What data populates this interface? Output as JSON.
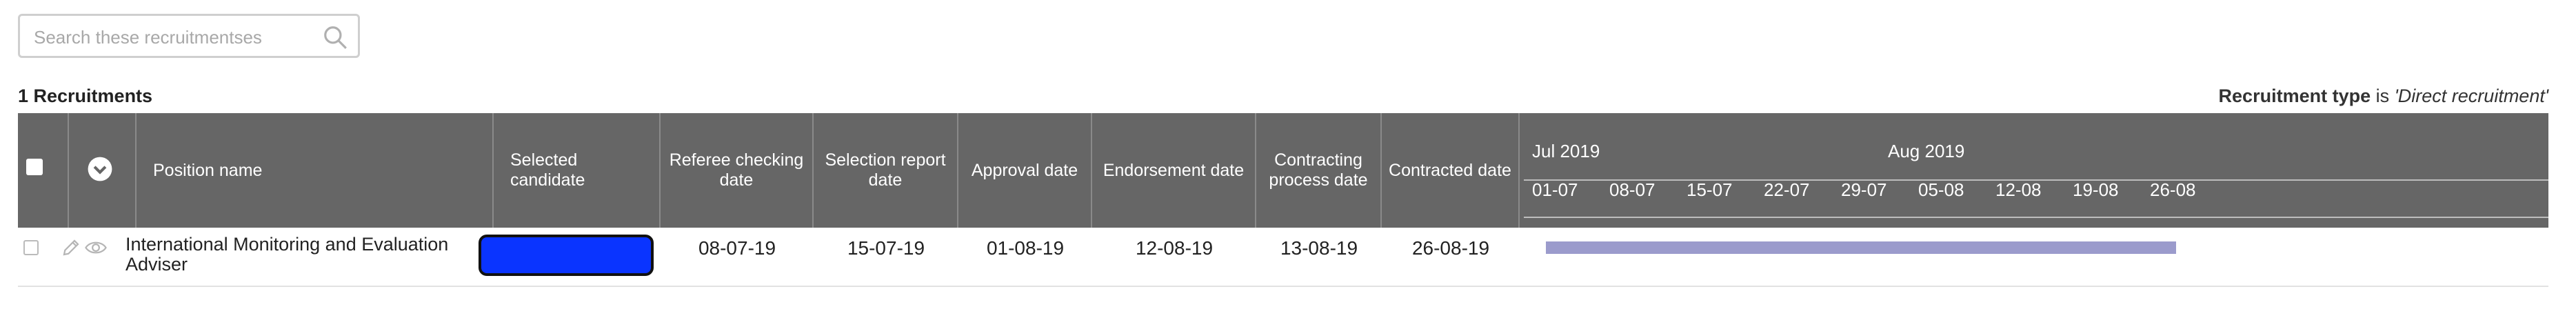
{
  "search": {
    "placeholder": "Search these recruitmentses",
    "value": ""
  },
  "summary": {
    "count_label": "1 Recruitments",
    "filter_key": "Recruitment type",
    "filter_op": "is",
    "filter_value": "'Direct recruitment'"
  },
  "table": {
    "columns": {
      "position_name": "Position name",
      "selected_candidate": "Selected candidate",
      "referee_checking_date": "Referee checking date",
      "selection_report_date": "Selection report date",
      "approval_date": "Approval date",
      "endorsement_date": "Endorsement date",
      "contracting_process_date": "Contracting process date",
      "contracted_date": "Contracted date"
    },
    "gantt": {
      "months": [
        "Jul 2019",
        "Aug 2019"
      ],
      "weeks": [
        "01-07",
        "08-07",
        "15-07",
        "22-07",
        "29-07",
        "05-08",
        "12-08",
        "19-08",
        "26-08"
      ]
    },
    "rows": [
      {
        "position_name": "International Monitoring and Evaluation Adviser",
        "selected_candidate_color": "#0a34ff",
        "referee_checking_date": "08-07-19",
        "selection_report_date": "15-07-19",
        "approval_date": "01-08-19",
        "endorsement_date": "12-08-19",
        "contracting_process_date": "13-08-19",
        "contracted_date": "26-08-19",
        "bar_color": "#9b9bcc"
      }
    ]
  },
  "icons": [
    "search-icon",
    "chevron-down-icon",
    "pencil-icon",
    "eye-icon"
  ]
}
